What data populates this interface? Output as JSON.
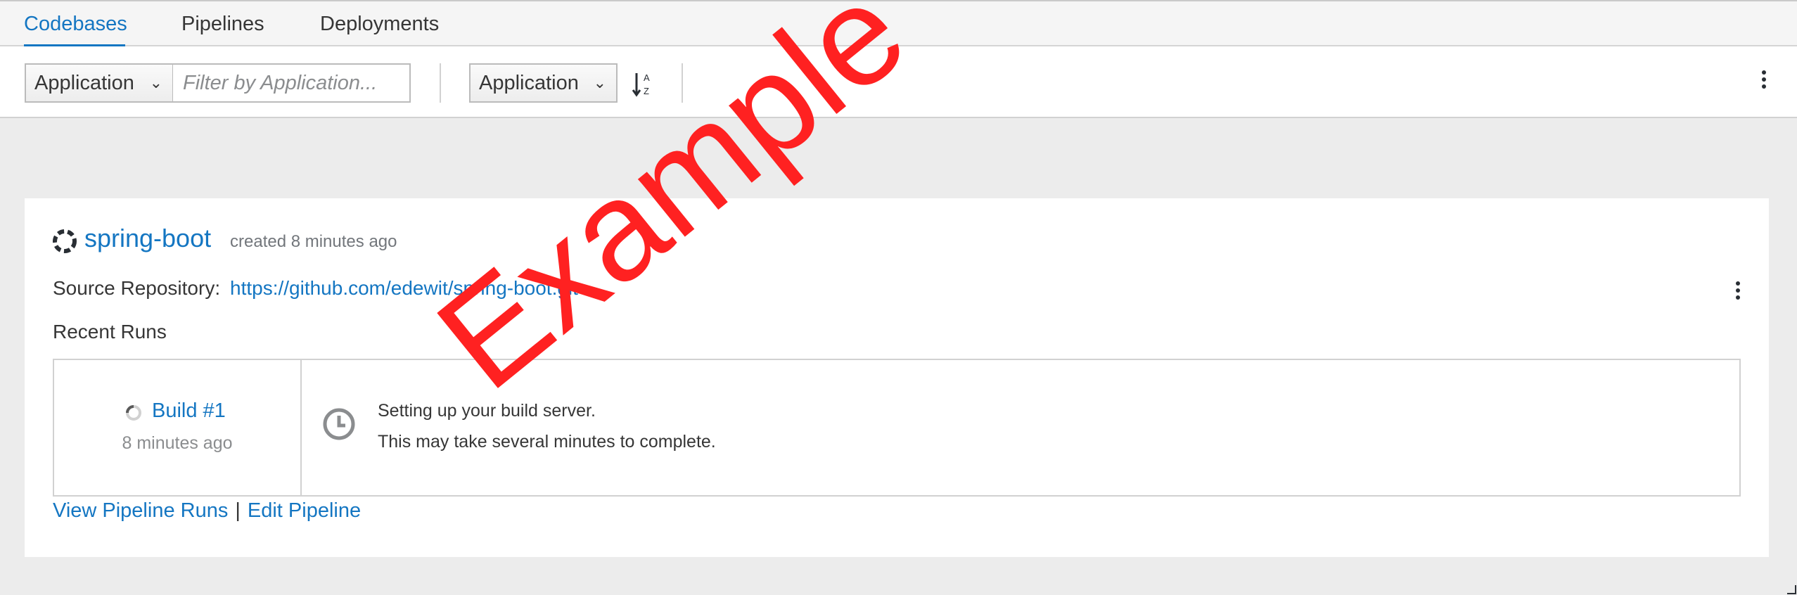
{
  "tabs": [
    {
      "label": "Codebases",
      "active": true
    },
    {
      "label": "Pipelines",
      "active": false
    },
    {
      "label": "Deployments",
      "active": false
    }
  ],
  "toolbar": {
    "filter_field_label": "Application",
    "filter_placeholder": "Filter by Application...",
    "sort_field_label": "Application",
    "sort_icon": "sort-alpha-asc-icon"
  },
  "codebase": {
    "name": "spring-boot",
    "created": "created 8 minutes ago",
    "status_icon": "spinner-icon",
    "source_label": "Source Repository:",
    "source_url": "https://github.com/edewit/spring-boot.git",
    "recent_runs_title": "Recent Runs",
    "runs": [
      {
        "build_label": "Build #1",
        "time": "8 minutes ago",
        "message_line1": "Setting up your build server.",
        "message_line2": "This may take several minutes to complete."
      }
    ],
    "links": {
      "view_runs": "View Pipeline Runs",
      "separator": "|",
      "edit_pipeline": "Edit Pipeline"
    }
  },
  "watermark": "Example",
  "colors": {
    "accent": "#1476c2",
    "watermark": "#ff2121",
    "background": "#ececec",
    "muted_text": "#8b8d8f"
  }
}
